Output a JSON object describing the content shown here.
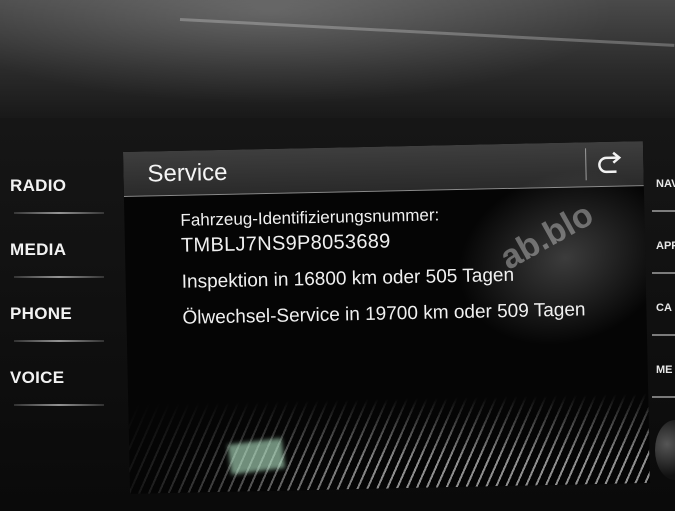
{
  "left_keys": [
    {
      "label": "RADIO"
    },
    {
      "label": "MEDIA"
    },
    {
      "label": "PHONE"
    },
    {
      "label": "VOICE"
    }
  ],
  "right_keys": [
    {
      "label": "NAV"
    },
    {
      "label": "APP"
    },
    {
      "label": "CA"
    },
    {
      "label": "ME"
    }
  ],
  "screen": {
    "title": "Service",
    "back_icon": "back-arrow-icon",
    "vin_label": "Fahrzeug-Identifizierungsnummer:",
    "vin_value": "TMBLJ7NS9P8053689",
    "inspection": "Inspektion in 16800 km oder 505 Tagen",
    "oil_service": "Ölwechsel-Service in 19700 km oder 509 Tagen",
    "watermark": "ab.blo"
  }
}
